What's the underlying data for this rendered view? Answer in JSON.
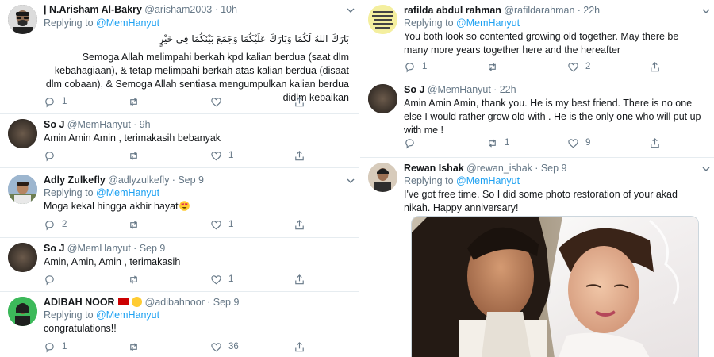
{
  "reply_prefix": "Replying to",
  "tweets_left": [
    {
      "name": "| N.Arisham Al-Bakry",
      "handle": "@arisham2003",
      "time": "10h",
      "replying_to": "@MemHanyut",
      "arabic": "بَارَكَ اللهُ لَكُمَا وَبَارَكَ عَلَيْكُمَا وَجَمَعَ بَيْنَكُمَا فِي خَيْرٍ",
      "text": "Semoga Allah melimpahi berkah kpd kalian berdua (saat dlm kebahagiaan), & tetap melimpahi berkah atas kalian berdua (disaat dlm cobaan), & Semoga Allah sentiasa mengumpulkan kalian berdua didlm kebaikan",
      "replies": "1",
      "retweets": "",
      "likes": ""
    },
    {
      "name": "So J",
      "handle": "@MemHanyut",
      "time": "9h",
      "text": "Amin Amin Amin , terimakasih bebanyak",
      "replies": "",
      "retweets": "",
      "likes": "1"
    },
    {
      "name": "Adly Zulkefly",
      "handle": "@adlyzulkefly",
      "time": "Sep 9",
      "replying_to": "@MemHanyut",
      "text": "Moga kekal hingga akhir hayat",
      "replies": "2",
      "retweets": "",
      "likes": "1"
    },
    {
      "name": "So J",
      "handle": "@MemHanyut",
      "time": "Sep 9",
      "text": "Amin, Amin, Amin , terimakasih",
      "replies": "",
      "retweets": "",
      "likes": "1"
    },
    {
      "name": "ADIBAH NOOR",
      "handle": "@adibahnoor",
      "time": "Sep 9",
      "replying_to": "@MemHanyut",
      "text": "congratulations!!",
      "replies": "1",
      "retweets": "",
      "likes": "36"
    }
  ],
  "tweets_right": [
    {
      "name": "rafilda abdul rahman",
      "handle": "@rafildarahman",
      "time": "22h",
      "replying_to": "@MemHanyut",
      "text": "You both look so contented growing old together. May there be many more years together here and the hereafter",
      "replies": "1",
      "retweets": "",
      "likes": "2"
    },
    {
      "name": "So J",
      "handle": "@MemHanyut",
      "time": "22h",
      "text": "Amin Amin Amin, thank you. He is my best friend. There is no one else I would rather grow old with . He is the only one who will put up with me !",
      "replies": "",
      "retweets": "1",
      "likes": "9"
    },
    {
      "name": "Rewan Ishak",
      "handle": "@rewan_ishak",
      "time": "Sep 9",
      "replying_to": "@MemHanyut",
      "text": "I've got free time. So I did some photo restoration of your akad nikah. Happy anniversary!"
    }
  ],
  "colors": {
    "link": "#1da1f2",
    "muted": "#657786",
    "divider": "#e6ecf0"
  },
  "icons": [
    "reply-icon",
    "retweet-icon",
    "like-icon",
    "share-icon",
    "caret-down-icon"
  ]
}
